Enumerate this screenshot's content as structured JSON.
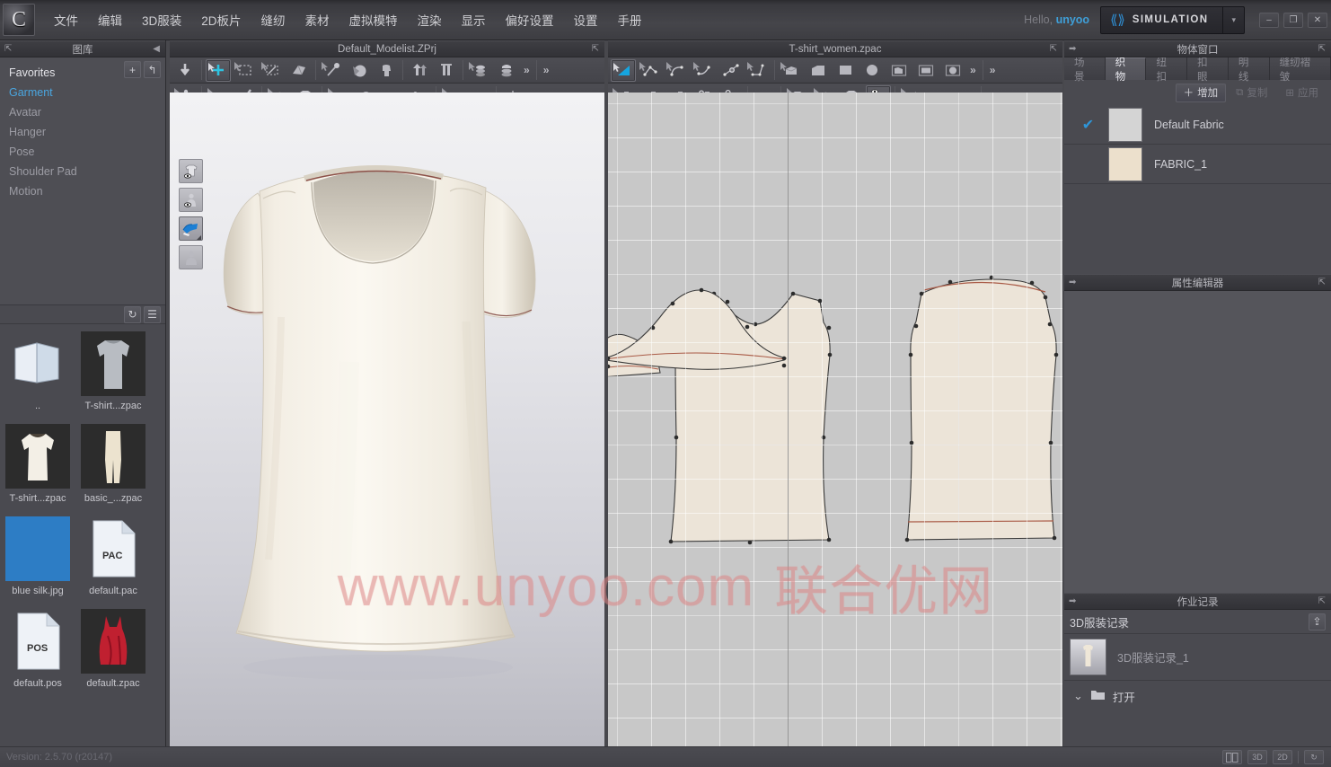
{
  "app": {
    "logo_glyph": "C",
    "watermark": "www.unyoo.com",
    "watermark_cn": "联合优网"
  },
  "menubar": {
    "items": [
      "文件",
      "编辑",
      "3D服装",
      "2D板片",
      "缝纫",
      "素材",
      "虚拟模特",
      "渲染",
      "显示",
      "偏好设置",
      "设置",
      "手册"
    ],
    "greeting_prefix": "Hello,",
    "user": "unyoo",
    "mode_label": "SIMULATION",
    "mode_caret": "▾",
    "window_buttons": [
      "–",
      "❐",
      "✕"
    ]
  },
  "library": {
    "title": "图库",
    "collapse_icon": "◀",
    "add_label": "+",
    "back_label": "↰",
    "tree": [
      {
        "label": "Favorites",
        "state": "head"
      },
      {
        "label": "Garment",
        "state": "selected"
      },
      {
        "label": "Avatar",
        "state": "normal"
      },
      {
        "label": "Hanger",
        "state": "normal"
      },
      {
        "label": "Pose",
        "state": "normal"
      },
      {
        "label": "Shoulder Pad",
        "state": "normal"
      },
      {
        "label": "Motion",
        "state": "normal"
      }
    ],
    "toolbar": {
      "refresh_icon": "↻",
      "list_icon": "☰"
    },
    "files": [
      {
        "name": "..",
        "kind": "folder-up"
      },
      {
        "name": "T-shirt...zpac",
        "kind": "tshirt-grey"
      },
      {
        "name": "T-shirt...zpac",
        "kind": "tshirt-white"
      },
      {
        "name": "basic_...zpac",
        "kind": "pants"
      },
      {
        "name": "blue silk.jpg",
        "kind": "swatch-blue"
      },
      {
        "name": "default.pac",
        "kind": "file-pac",
        "badge": "PAC"
      },
      {
        "name": "default.pos",
        "kind": "file-pos",
        "badge": "POS"
      },
      {
        "name": "default.zpac",
        "kind": "dress-red"
      }
    ]
  },
  "viewport3d": {
    "title": "Default_Modelist.ZPrj",
    "expand_icon": "⇱",
    "overflow": "»",
    "view_modes": [
      {
        "name": "show-garment",
        "active": false
      },
      {
        "name": "show-avatar",
        "active": false
      },
      {
        "name": "show-fabric-layer",
        "active": true
      },
      {
        "name": "show-mannequin",
        "active": false
      }
    ]
  },
  "viewport2d": {
    "title": "T-shirt_women.zpac",
    "expand_icon": "⇱",
    "overflow": "»"
  },
  "object_window": {
    "title": "物体窗口",
    "pin_icon": "➡",
    "expand_icon": "⇱",
    "tabs": [
      {
        "label": "场景",
        "active": false
      },
      {
        "label": "织物",
        "active": true
      },
      {
        "label": "纽扣",
        "active": false
      },
      {
        "label": "扣眼",
        "active": false
      },
      {
        "label": "明线",
        "active": false
      },
      {
        "label": "缝纫褶皱",
        "active": false
      }
    ],
    "actions": [
      {
        "label": "增加",
        "icon": "＋",
        "enabled": true
      },
      {
        "label": "复制",
        "icon": "⧉",
        "enabled": false
      },
      {
        "label": "应用",
        "icon": "⊞",
        "enabled": false
      }
    ],
    "fabrics": [
      {
        "name": "Default Fabric",
        "checked": true,
        "swatch": "#d4d4d4"
      },
      {
        "name": "FABRIC_1",
        "checked": false,
        "swatch": "#ece0cc"
      }
    ]
  },
  "property_editor": {
    "title": "属性编辑器",
    "pin_icon": "➡",
    "expand_icon": "⇱"
  },
  "job_log": {
    "title": "作业记录",
    "pin_icon": "➡",
    "expand_icon": "⇱",
    "section_label": "3D服装记录",
    "section_icon": "⇪",
    "items": [
      {
        "label": "3D服装记录_1"
      }
    ],
    "open_label": "打开",
    "open_chevron": "⌄"
  },
  "status_bar": {
    "version": "Version: 2.5.70     (r20147)",
    "buttons": [
      {
        "label": "",
        "name": "split-view-button"
      },
      {
        "label": "3D",
        "name": "view-3d-button"
      },
      {
        "label": "2D",
        "name": "view-2d-button"
      },
      {
        "label": "↻",
        "name": "reset-view-button"
      }
    ]
  }
}
